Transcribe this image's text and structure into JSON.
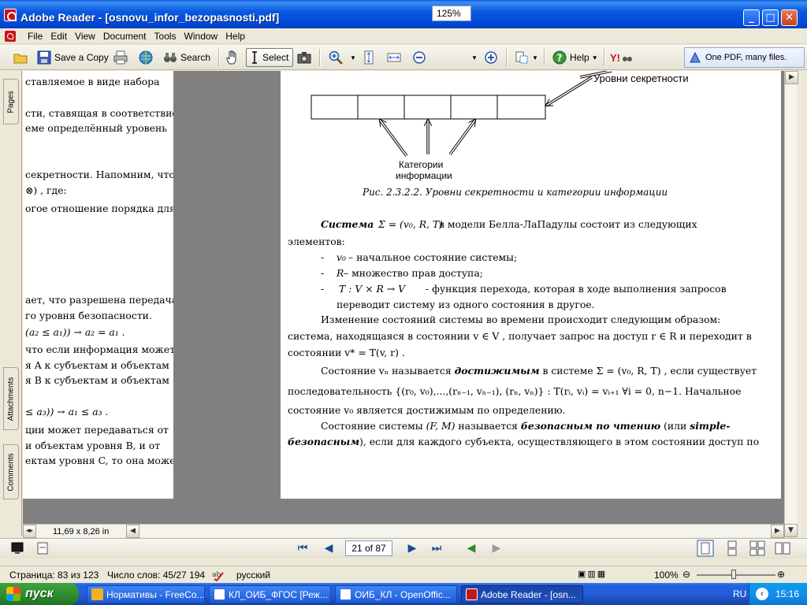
{
  "window": {
    "title": "Adobe Reader - [osnovu_infor_bezopasnosti.pdf]",
    "controls": {
      "minimize": "_",
      "maximize": "□",
      "close": "✕"
    }
  },
  "menu": [
    "File",
    "Edit",
    "View",
    "Document",
    "Tools",
    "Window",
    "Help"
  ],
  "toolbar": {
    "save_copy": "Save a Copy",
    "search": "Search",
    "select": "Select",
    "zoom_value": "125%",
    "help": "Help",
    "banner": "One PDF, many files."
  },
  "nav_tabs": {
    "pages": "Pages",
    "attachments": "Attachments",
    "comments": "Comments"
  },
  "left_page_lines": [
    "ставляемое  в  виде  набора",
    "сти, ставящая в соответствие",
    "еме    определённый    уровень",
    "секретности.  Напомним,  что",
    "⊗) , где:",
    "огое  отношение  порядка  для",
    "ает,  что разрешена передача",
    "го уровня безопасности.",
    "(a₂ ≤ a₁)) → a₂ = a₁ .",
    " что если информация может",
    "я  A  к субъектам и объектам",
    "я  B  к субъектам и объектам",
    "≤ a₃)) → a₁ ≤ a₃ .",
    "ции  может  передаваться  от",
    "и  объектам  уровня  B,  и  от",
    "ектам уровня C, то она может"
  ],
  "figure": {
    "label_levels": "Уровни секретности",
    "label_categories_1": "Категории",
    "label_categories_2": "информации",
    "caption": "Рис. 2.3.2.2. Уровни секретности и категории информации"
  },
  "right_page": {
    "p1_a": "Система",
    "p1_b": "Σ = (v₀, R, T)",
    "p1_c": "в    модели    Белла-ЛаПадулы    состоит    из    следующих",
    "p1_d": "элементов:",
    "li1_v": "v₀",
    "li1_t": " – начальное состояние системы;",
    "li2_v": "R",
    "li2_t": " – множество прав доступа;",
    "li3_v": "T : V × R → V",
    "li3_t": "  -  функция  перехода,  которая  в  ходе  выполнения  запросов",
    "li3_t2": "переводит систему из одного состояния в другое.",
    "p2_1": "Изменение  состояний  системы  во  времени  происходит  следующим  образом:",
    "p2_2": "система,  находящаяся  в  состоянии   v ∈ V ,  получает  запрос  на  доступ   r ∈ R   и  переходит  в",
    "p2_3": "состоянии   v* = T(v, r) .",
    "p3_1a": "Состояние  vₙ  называется ",
    "p3_1b": "достижимым",
    "p3_1c": " в  системе   Σ = (v₀, R, T) ,  если  существует",
    "p3_2": "последовательность        {(r₀, v₀),...,(rₙ₋₁, vₙ₋₁), (rₙ, vₙ)} : T(rᵢ, vᵢ) = vᵢ₊₁ ∀i = 0, n−1.      Начальное",
    "p3_3": "состояние v₀ является достижимым по определению.",
    "p4_1a": "Состояние  системы  ",
    "p4_1b": "(F,  M)",
    "p4_1c": "  называется  ",
    "p4_1d": "безопасным  по  чтению",
    "p4_1e": "  (или  ",
    "p4_1f": "simple-",
    "p4_2a": "безопасным",
    "p4_2b": "),  если  для  каждого  субъекта,  осуществляющего  в  этом  состоянии  доступ  по"
  },
  "page_size": "11,69 x 8,26 in",
  "navigation": {
    "page_field": "21 of 87"
  },
  "statusbar": {
    "page": "Страница: 83 из 123",
    "words": "Число слов: 45/27 194",
    "language": "русский",
    "zoom": "100%"
  },
  "taskbar": {
    "start": "пуск",
    "tasks": [
      "Нормативы - FreeCo...",
      "КЛ_ОИБ_ФГОС [Реж...",
      "ОИБ_КЛ - OpenOffic...",
      "Adobe Reader - [osn..."
    ],
    "lang": "RU",
    "clock": "15:16"
  }
}
